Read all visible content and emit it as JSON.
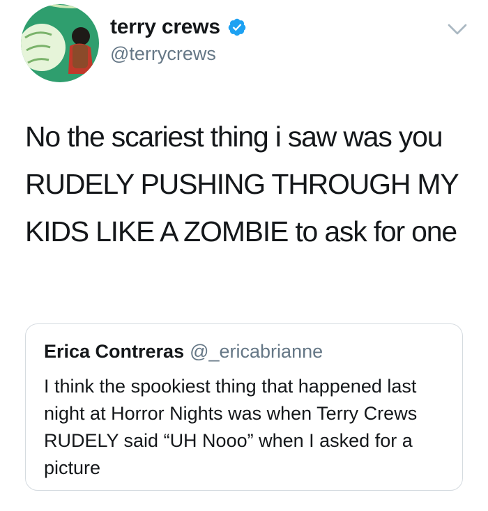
{
  "author": {
    "display_name": "terry crews",
    "handle": "@terrycrews",
    "avatar_icon": "profile-avatar-illustration",
    "verified_icon": "verified-badge-icon",
    "verified_color": "#1da1f2"
  },
  "menu": {
    "icon": "chevron-down-icon"
  },
  "tweet": {
    "text": "No the scariest thing i saw was you RUDELY PUSHING THROUGH MY KIDS LIKE A ZOMBIE to ask for one"
  },
  "quoted_tweet": {
    "display_name": "Erica Contreras",
    "handle": "@_ericabrianne",
    "text": "I think the spookiest thing that happened last night at Horror Nights was when Terry Crews RUDELY said “UH Nooo” when I asked for a picture"
  },
  "colors": {
    "text": "#14171a",
    "secondary_text": "#657786",
    "border": "#d5dbe0"
  }
}
